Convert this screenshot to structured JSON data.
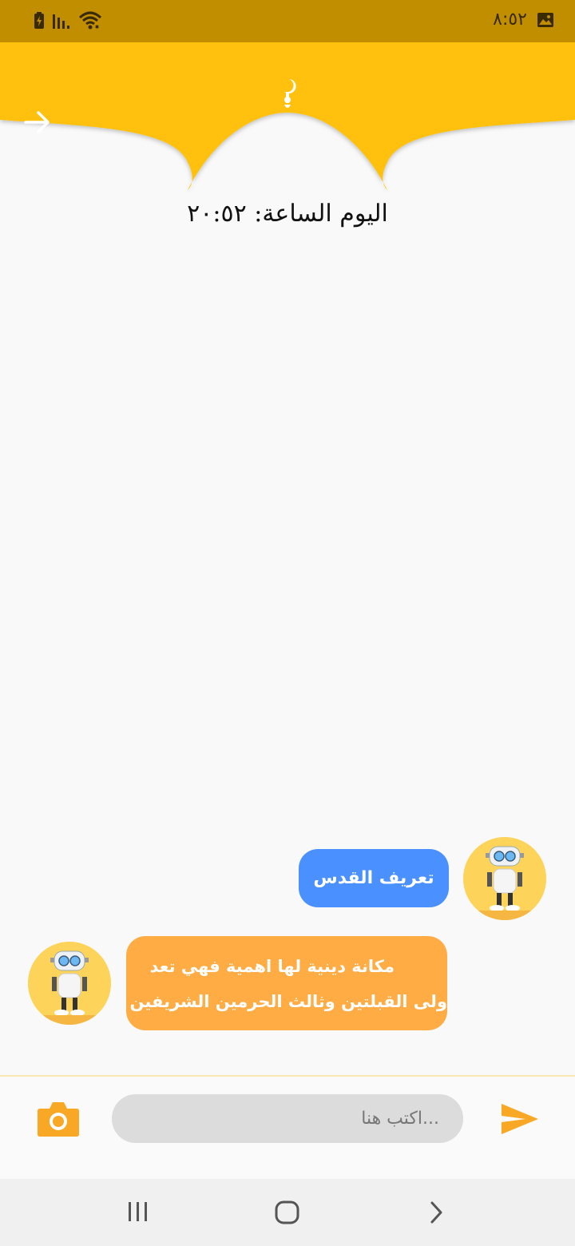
{
  "status_bar": {
    "time": "٨:٥٢",
    "icons": [
      "battery-charging-icon",
      "signal-icon",
      "wifi-icon",
      "image-icon"
    ]
  },
  "header": {
    "title": "اليوم الساعة: ٢٠:٥٢",
    "colors": {
      "bar": "#ffc107",
      "status": "#c18e00"
    }
  },
  "chat": {
    "messages": [
      {
        "sender": "user",
        "text": "تعريف القدس",
        "color": "#4a90ff"
      },
      {
        "sender": "bot",
        "lines": [
          "مكانة دينية لها اهمية فهي تعد",
          "ولى القبلتين وثالث الحرمين الشريفين"
        ],
        "color": "#ffac45"
      }
    ]
  },
  "composer": {
    "placeholder": "...اكتب هنا",
    "accent": "#f9a825"
  },
  "nav": {
    "icons": [
      "recent-apps-icon",
      "home-icon",
      "back-icon"
    ]
  }
}
